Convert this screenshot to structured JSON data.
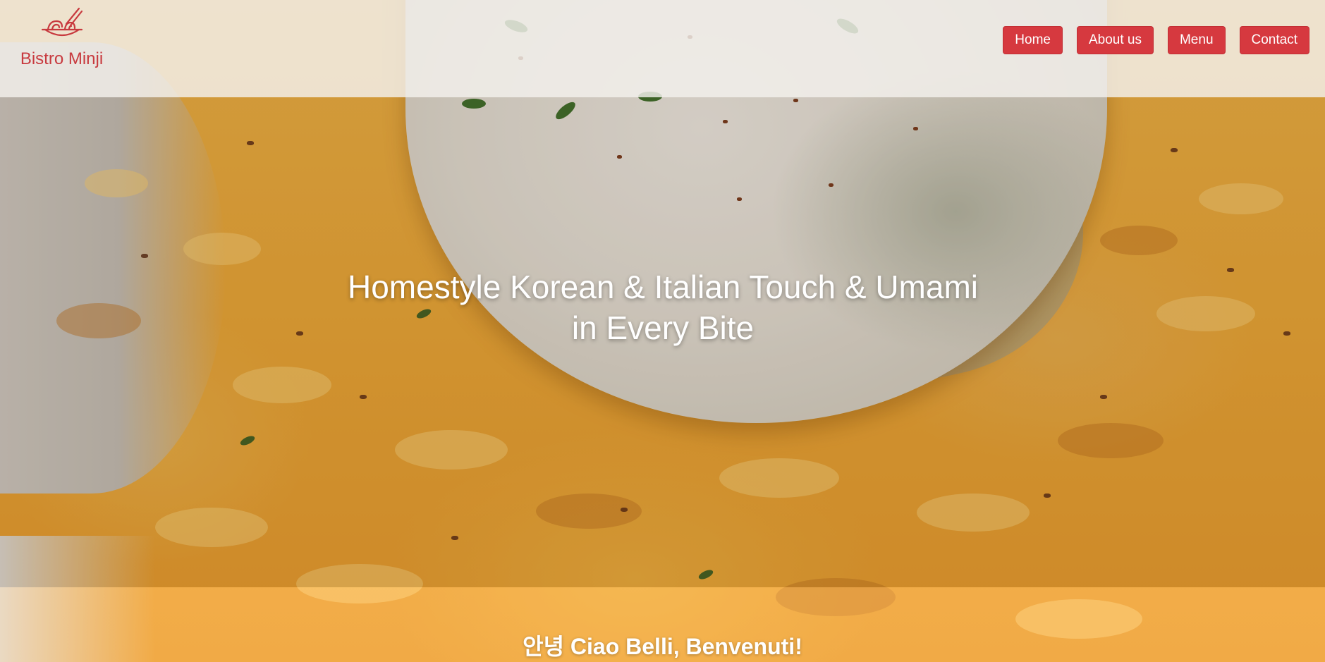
{
  "brand": {
    "name": "Bistro Minji",
    "logo_icon": "noodle-bowl-icon",
    "accent_color": "#d6393f"
  },
  "nav": {
    "items": [
      {
        "label": "Home"
      },
      {
        "label": "About us"
      },
      {
        "label": "Menu"
      },
      {
        "label": "Contact"
      }
    ]
  },
  "hero": {
    "heading_line1": "Homestyle Korean & Italian Touch & Umami",
    "heading_line2": "in Every Bite",
    "background_image": "risotto-with-burrata-photo"
  },
  "welcome": {
    "text": "안녕 Ciao Belli, Benvenuti!"
  }
}
